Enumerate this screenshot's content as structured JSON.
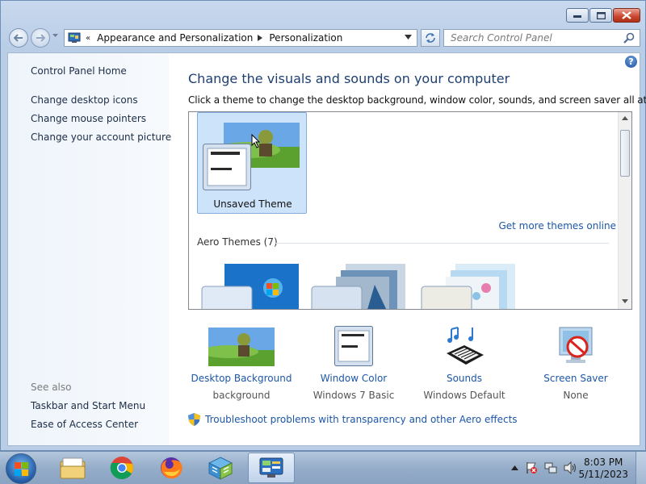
{
  "window": {
    "controls": [
      "minimize",
      "maximize",
      "close"
    ]
  },
  "nav": {
    "breadcrumb": [
      "Appearance and Personalization",
      "Personalization"
    ],
    "breadcrumb_prefix": "«",
    "search_placeholder": "Search Control Panel"
  },
  "sidebar": {
    "home": "Control Panel Home",
    "links": [
      "Change desktop icons",
      "Change mouse pointers",
      "Change your account picture"
    ],
    "see_also_title": "See also",
    "see_also": [
      "Taskbar and Start Menu",
      "Ease of Access Center"
    ]
  },
  "main": {
    "heading": "Change the visuals and sounds on your computer",
    "subtext": "Click a theme to change the desktop background, window color, sounds, and screen saver all at once.",
    "selected_theme": "Unsaved Theme",
    "get_more": "Get more themes online",
    "group_title": "Aero Themes (7)",
    "help_glyph": "?"
  },
  "settings": [
    {
      "label": "Desktop Background",
      "value": "background",
      "icon": "desktop-background-icon"
    },
    {
      "label": "Window Color",
      "value": "Windows 7 Basic",
      "icon": "window-color-icon"
    },
    {
      "label": "Sounds",
      "value": "Windows Default",
      "icon": "sounds-icon"
    },
    {
      "label": "Screen Saver",
      "value": "None",
      "icon": "screen-saver-icon"
    }
  ],
  "troubleshoot": "Troubleshoot problems with transparency and other Aero effects",
  "taskbar": {
    "apps": [
      "windows-explorer-icon",
      "chrome-icon",
      "firefox-icon",
      "app-installer-icon",
      "control-panel-icon"
    ],
    "time": "8:03 PM",
    "date": "5/11/2023"
  },
  "colors": {
    "link": "#1c56a8",
    "heading": "#1d3f72",
    "selection": "#cde3f9"
  }
}
